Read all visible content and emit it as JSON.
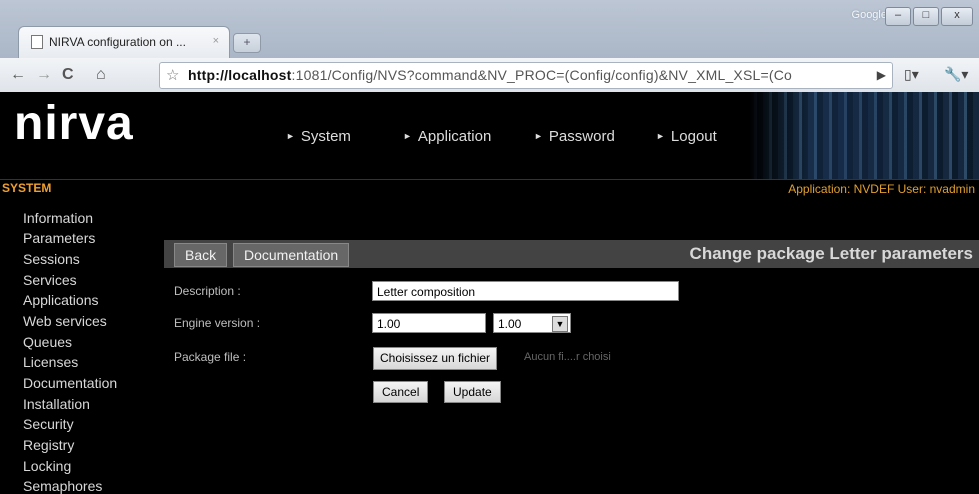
{
  "browser": {
    "tab_title": "NIRVA configuration on ...",
    "tab_close": "×",
    "new_tab": "+",
    "window_label": "Google",
    "url_host": "http://localhost",
    "url_rest": ":1081/Config/NVS?command&NV_PROC=(Config/config)&NV_XML_XSL=(Co",
    "minimize": "–",
    "maximize": "□",
    "close": "x"
  },
  "header": {
    "logo": "nirva",
    "nav": [
      "System",
      "Application",
      "Password",
      "Logout"
    ]
  },
  "system_bar": {
    "section": "SYSTEM",
    "info": "Application: NVDEF  User: nvadmin"
  },
  "sidebar": {
    "items": [
      "Information",
      "Parameters",
      "Sessions",
      "Services",
      "Applications",
      "Web services",
      "Queues",
      "Licenses",
      "Documentation",
      "Installation",
      "Security",
      "Registry",
      "Locking",
      "Semaphores"
    ]
  },
  "toolbar": {
    "back": "Back",
    "documentation": "Documentation",
    "title": "Change package Letter parameters"
  },
  "form": {
    "description_label": "Description :",
    "description_value": "Letter composition",
    "engine_label": "Engine version :",
    "engine_value": "1.00",
    "engine_select": "1.00",
    "package_label": "Package file :",
    "file_button": "Choisissez un fichier",
    "file_status": "Aucun fi....r choisi",
    "cancel": "Cancel",
    "update": "Update"
  }
}
